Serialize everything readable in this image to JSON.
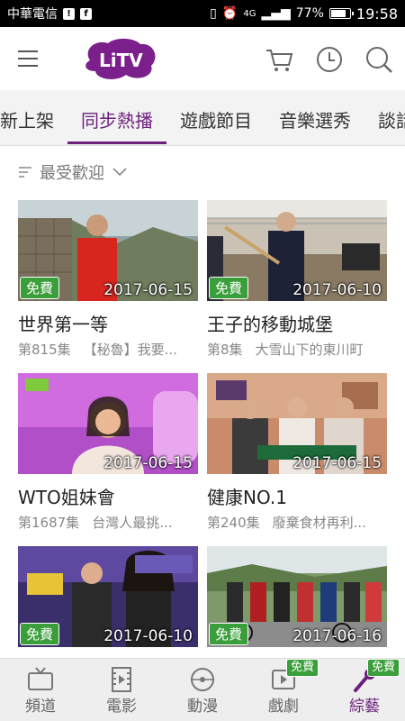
{
  "status": {
    "carrier": "中華電信",
    "network": "4G",
    "battery": "77%",
    "time": "19:58"
  },
  "header": {
    "logo_text": "LiTV",
    "icons": [
      "menu-icon",
      "cart-icon",
      "history-icon",
      "search-icon"
    ]
  },
  "tabs": [
    "新上架",
    "同步熱播",
    "遊戲節目",
    "音樂選秀",
    "談話"
  ],
  "active_tab": "同步熱播",
  "sort": {
    "label": "最受歡迎"
  },
  "cards": [
    {
      "free": "免費",
      "date": "2017-06-15",
      "title": "世界第一等",
      "episode": "第815集",
      "desc": "【秘魯】我要..."
    },
    {
      "free": "免費",
      "date": "2017-06-10",
      "title": "王子的移動城堡",
      "episode": "第8集",
      "desc": "大雪山下的東川町"
    },
    {
      "free": "",
      "date": "2017-06-15",
      "title": "WTO姐妹會",
      "episode": "第1687集",
      "desc": "台灣人最挑..."
    },
    {
      "free": "",
      "date": "2017-06-15",
      "title": "健康NO.1",
      "episode": "第240集",
      "desc": "廢棄食材再利..."
    },
    {
      "free": "免費",
      "date": "2017-06-10",
      "title": "",
      "episode": "",
      "desc": ""
    },
    {
      "free": "免費",
      "date": "2017-06-16",
      "title": "",
      "episode": "",
      "desc": ""
    }
  ],
  "bottom_nav": [
    {
      "label": "頻道",
      "icon": "tv-icon",
      "badge": ""
    },
    {
      "label": "電影",
      "icon": "film-icon",
      "badge": ""
    },
    {
      "label": "動漫",
      "icon": "disc-icon",
      "badge": ""
    },
    {
      "label": "戲劇",
      "icon": "play-icon",
      "badge": "免費"
    },
    {
      "label": "綜藝",
      "icon": "microphone-icon",
      "badge": "免費"
    }
  ],
  "colors": {
    "brand": "#6b1f7b",
    "free_badge": "#3a9e3a"
  }
}
